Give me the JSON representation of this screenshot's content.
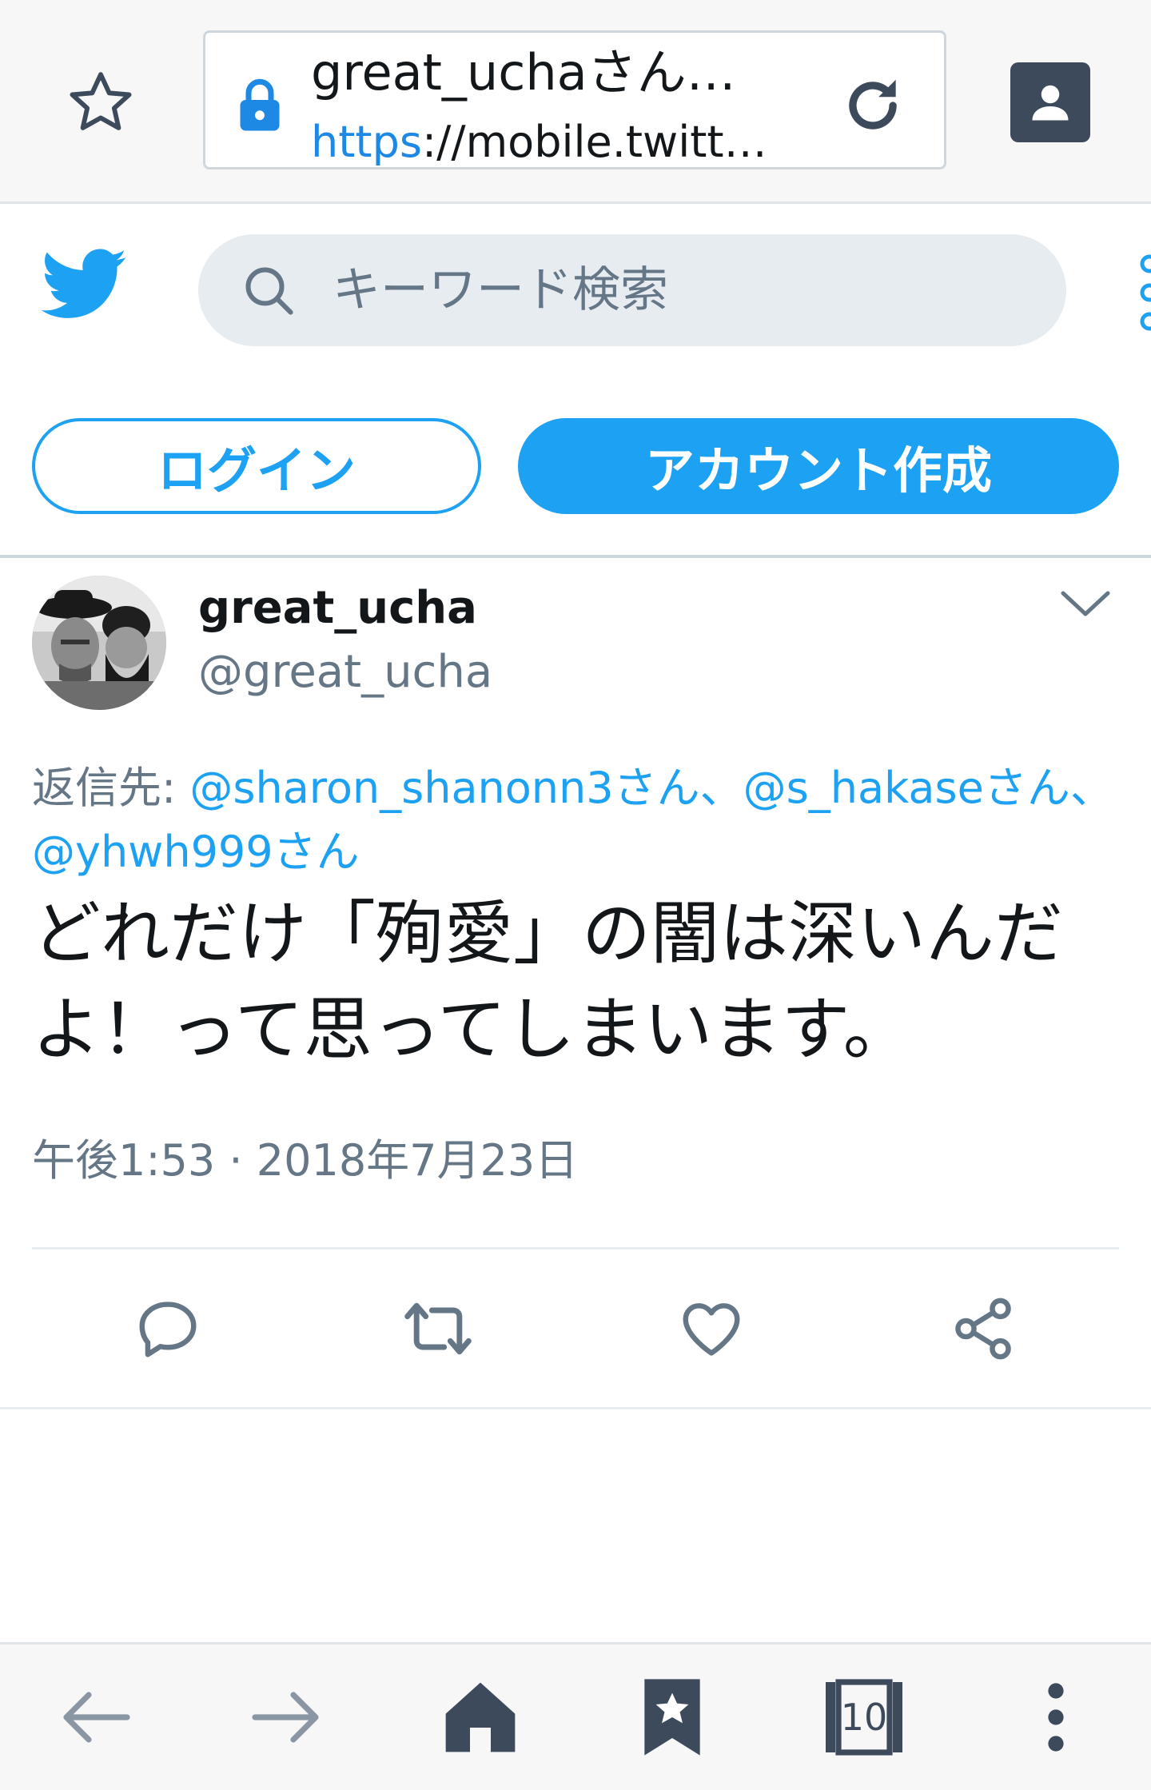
{
  "browser": {
    "page_title": "great_uchaさん…",
    "url_scheme": "https",
    "url_rest": "://mobile.twitt…",
    "tab_count": "10"
  },
  "header": {
    "search_placeholder": "キーワード検索",
    "login_label": "ログイン",
    "signup_label": "アカウント作成"
  },
  "tweet": {
    "display_name": "great_ucha",
    "screen_name": "@great_ucha",
    "reply_prefix": "返信先: ",
    "reply_mentions_1": "@sharon_shanonn3さん、@s_hakaseさん、@yhwh999さん",
    "text": "どれだけ「殉愛」の闇は深いんだよ！って思ってしまいます。",
    "timestamp": "午後1:53 · 2018年7月23日"
  },
  "colors": {
    "twitter_blue": "#1da1f2",
    "text_primary": "#14171a",
    "text_secondary": "#657786",
    "icon_dark": "#3d4a5c"
  },
  "icons": {
    "bookmark": "star-outline-icon",
    "lock": "lock-icon",
    "reload": "reload-icon",
    "account": "account-icon",
    "twitter": "twitter-bird-icon",
    "search": "search-icon",
    "chevron": "chevron-down-icon",
    "reply": "reply-icon",
    "retweet": "retweet-icon",
    "like": "heart-icon",
    "share": "share-icon",
    "back": "arrow-left-icon",
    "forward": "arrow-right-icon",
    "home": "home-icon",
    "bookmarks": "bookmark-star-icon",
    "tabs": "tabs-icon",
    "menu": "kebab-menu-icon"
  }
}
